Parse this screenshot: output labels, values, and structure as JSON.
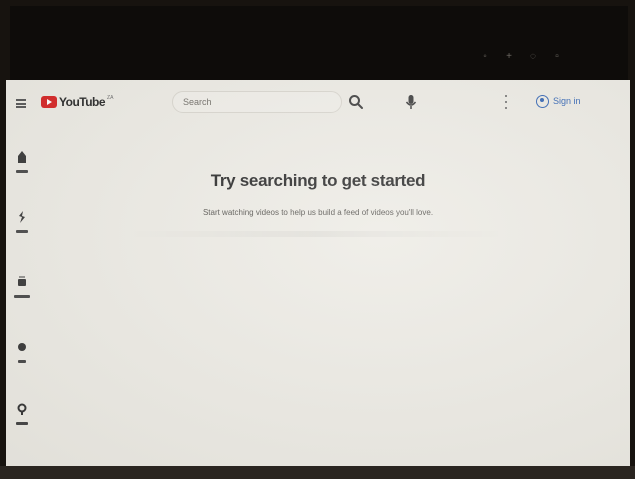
{
  "masthead": {
    "logo_text": "YouTube",
    "logo_suffix": "ZA",
    "search_placeholder": "Search",
    "signin_label": "Sign in"
  },
  "rail": {
    "items": [
      {
        "icon": "home-icon"
      },
      {
        "icon": "shorts-icon"
      },
      {
        "icon": "subscriptions-icon"
      },
      {
        "icon": "you-icon"
      },
      {
        "icon": "history-icon"
      }
    ]
  },
  "empty_state": {
    "title": "Try searching to get started",
    "subtitle": "Start watching videos to help us build a feed of videos you'll love."
  },
  "colors": {
    "brand_red": "#d42020",
    "signin_blue": "#2b5fb0",
    "page_background": "#ebe9e2"
  }
}
